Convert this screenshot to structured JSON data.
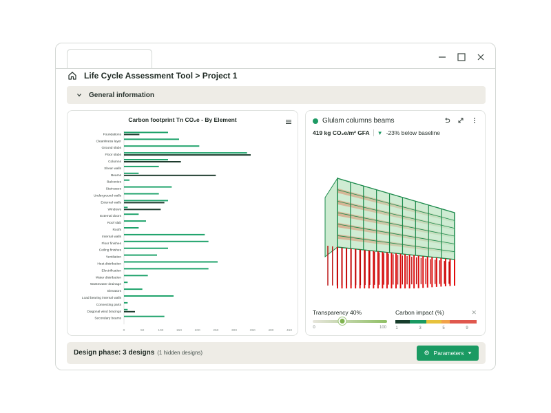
{
  "breadcrumb": {
    "title": "Life Cycle Assessment Tool > Project 1"
  },
  "section": {
    "label": "General information"
  },
  "chart_data": {
    "type": "bar",
    "orientation": "horizontal",
    "title": "Carbon footprint Tn CO₂e - By Element",
    "categories": [
      "Foundations",
      "Cleanliness layer",
      "Ground slabs",
      "Floor slabs",
      "Columns",
      "Shear walls",
      "Beams",
      "Balconies",
      "Staircases",
      "Underground walls",
      "External walls",
      "Windows",
      "External doors",
      "Roof slab",
      "Roofs",
      "Internal walls",
      "Floor finishes",
      "Ceiling finishes",
      "Ventilation",
      "Heat distribution",
      "Electrification",
      "Water distribution",
      "Wastewater drainage",
      "Elevators",
      "Load bearing internal walls",
      "Connecting parts",
      "Diagonal wind bracings",
      "Secondary beams"
    ],
    "series": [
      {
        "color": "#1fa36b",
        "values": [
          120,
          150,
          205,
          335,
          120,
          95,
          40,
          15,
          130,
          95,
          120,
          10,
          40,
          60,
          40,
          220,
          230,
          120,
          90,
          255,
          230,
          65,
          10,
          50,
          135,
          10,
          10,
          110
        ]
      },
      {
        "color": "#1d3b2d",
        "values": [
          42,
          0,
          0,
          345,
          155,
          0,
          250,
          0,
          0,
          0,
          110,
          100,
          0,
          0,
          0,
          0,
          0,
          0,
          0,
          0,
          0,
          0,
          0,
          0,
          0,
          0,
          30,
          0
        ]
      }
    ],
    "xticks": [
      "0",
      "50",
      "100",
      "150",
      "200",
      "250",
      "300",
      "350",
      "400",
      "450"
    ],
    "xlim": [
      0,
      450
    ]
  },
  "viewer": {
    "title": "Glulam columns beams",
    "metric_value": "419 kg CO₂e/m² GFA",
    "metric_delta": "-23% below baseline",
    "building_colors": {
      "frame": "#1c8a4c",
      "glass": "#bfe6c4",
      "slab": "#d9a07e",
      "columns": "#e10d0d"
    }
  },
  "transparency": {
    "label": "Transparency 40%",
    "value": 40,
    "min_label": "0",
    "max_label": "100"
  },
  "carbon_impact": {
    "label": "Carbon impact (%)",
    "ticks": [
      "1",
      "3",
      "5",
      "9"
    ],
    "scale": [
      {
        "color": "#173d2c",
        "weight": 1
      },
      {
        "color": "#1a9a62",
        "weight": 1.1
      },
      {
        "color": "#e7c23c",
        "weight": 1
      },
      {
        "color": "#f2a24a",
        "weight": 0.6
      },
      {
        "color": "#e0584e",
        "weight": 1.8
      }
    ]
  },
  "footer": {
    "phase_main": "Design phase: 3 designs",
    "phase_sub": "(1 hidden designs)",
    "params_label": "Parameters"
  }
}
